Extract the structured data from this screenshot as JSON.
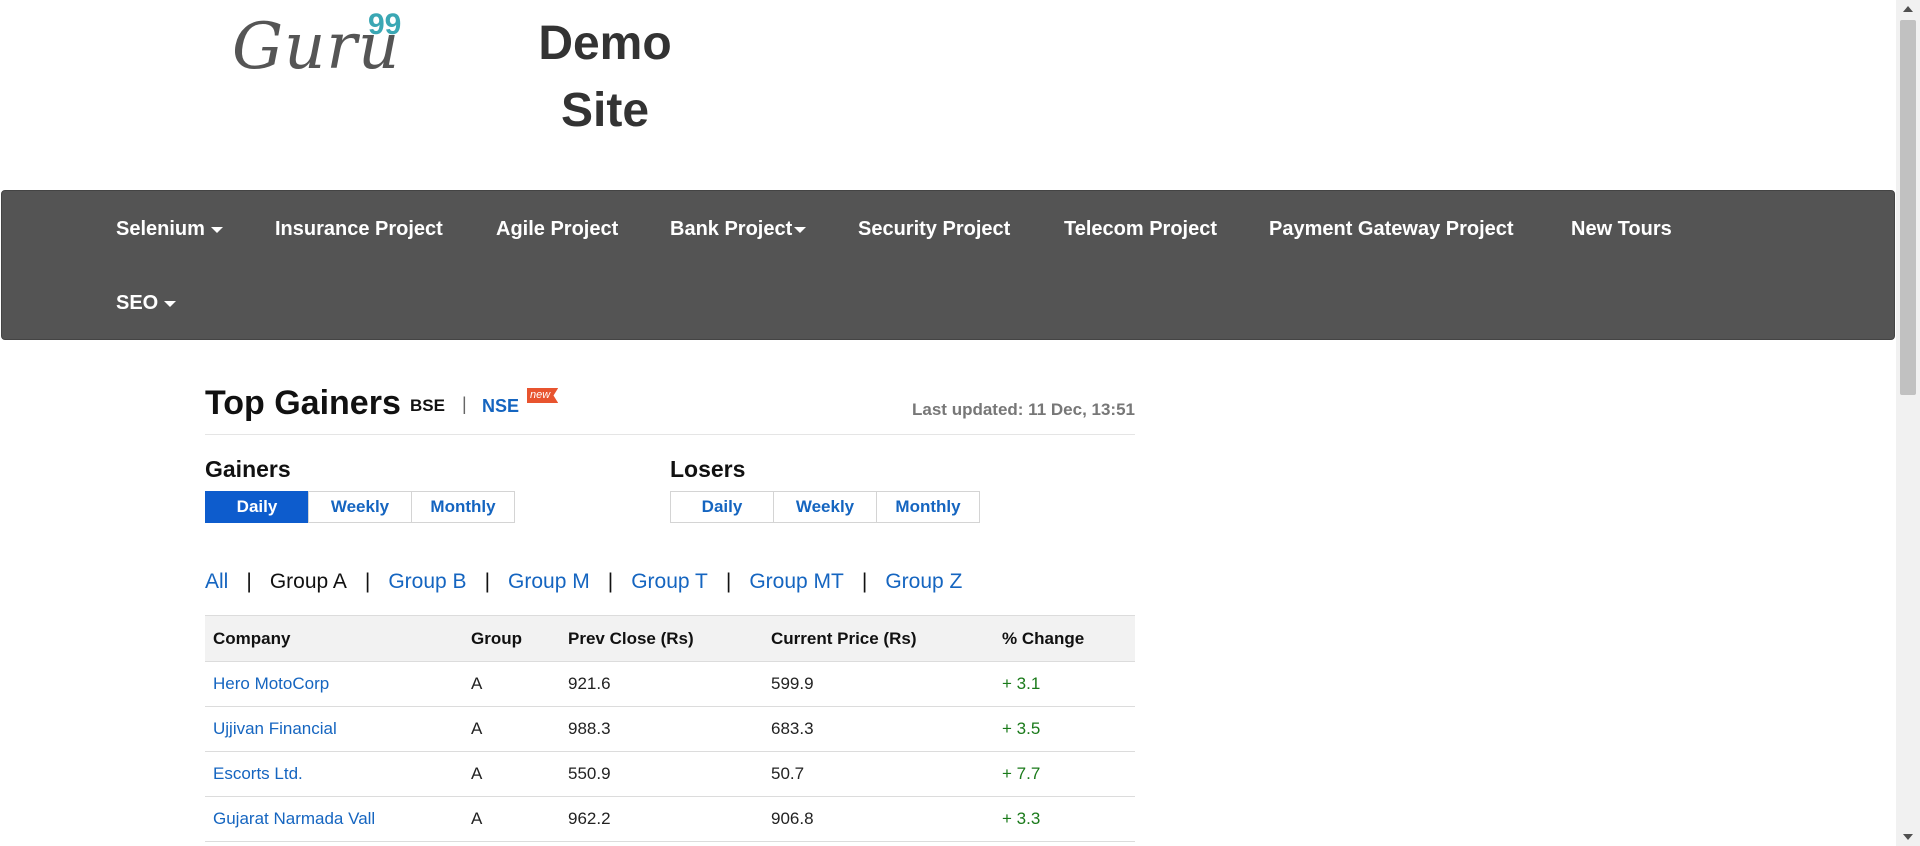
{
  "header": {
    "logo_text": "Guru",
    "logo_sup": "99",
    "title_line1": "Demo",
    "title_line2": "Site"
  },
  "navbar": {
    "items": [
      {
        "label": "Selenium",
        "dropdown": true
      },
      {
        "label": "Insurance Project",
        "dropdown": false
      },
      {
        "label": "Agile Project",
        "dropdown": false
      },
      {
        "label": "Bank Project",
        "dropdown": true
      },
      {
        "label": "Security Project",
        "dropdown": false
      },
      {
        "label": "Telecom Project",
        "dropdown": false
      },
      {
        "label": "Payment Gateway Project",
        "dropdown": false
      },
      {
        "label": "New Tours",
        "dropdown": false
      },
      {
        "label": "SEO",
        "dropdown": true
      }
    ]
  },
  "content": {
    "title": "Top Gainers",
    "bse": "BSE",
    "separator": "|",
    "nse": "NSE",
    "new_badge": "new",
    "last_updated": "Last updated: 11 Dec, 13:51",
    "gainers": {
      "label": "Gainers",
      "buttons": [
        "Daily",
        "Weekly",
        "Monthly"
      ],
      "active": "Daily"
    },
    "losers": {
      "label": "Losers",
      "buttons": [
        "Daily",
        "Weekly",
        "Monthly"
      ],
      "active": null
    },
    "groups": {
      "items": [
        "All",
        "Group A",
        "Group B",
        "Group M",
        "Group T",
        "Group MT",
        "Group Z"
      ],
      "active": "Group A",
      "separator": "|"
    },
    "table": {
      "headers": [
        "Company",
        "Group",
        "Prev Close (Rs)",
        "Current Price (Rs)",
        "% Change"
      ],
      "rows": [
        [
          "Hero MotoCorp",
          "A",
          "921.6",
          "599.9",
          "+ 3.1"
        ],
        [
          "Ujjivan Financial",
          "A",
          "988.3",
          "683.3",
          "+ 3.5"
        ],
        [
          "Escorts Ltd.",
          "A",
          "550.9",
          "50.7",
          "+ 7.7"
        ],
        [
          "Gujarat Narmada Vall",
          "A",
          "962.2",
          "906.8",
          "+ 3.3"
        ]
      ]
    }
  },
  "colors": {
    "navbar_bg": "#545454",
    "link_blue": "#1565c0",
    "active_button": "#0d5ccd",
    "positive_change": "#1a7a1a",
    "logo_accent": "#3aa7b4"
  }
}
